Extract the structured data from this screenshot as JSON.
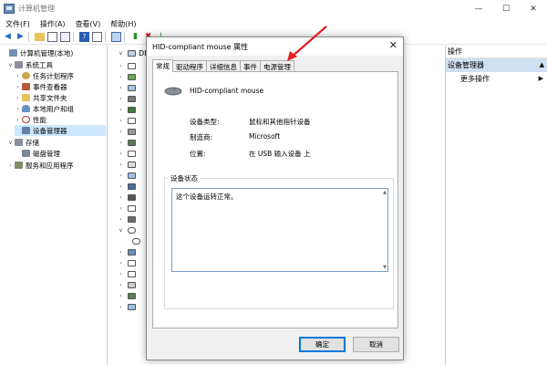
{
  "window": {
    "title": "计算机管理",
    "controls": [
      "—",
      "☐",
      "✕"
    ]
  },
  "menubar": [
    "文件(F)",
    "操作(A)",
    "查看(V)",
    "帮助(H)"
  ],
  "tree": {
    "root": "计算机管理(本地)",
    "system_tools": "系统工具",
    "task_scheduler": "任务计划程序",
    "event_viewer": "事件查看器",
    "shared_folders": "共享文件夹",
    "local_users": "本地用户和组",
    "performance": "性能",
    "device_manager": "设备管理器",
    "storage": "存储",
    "disk_management": "磁盘管理",
    "services": "服务和应用程序"
  },
  "middle": {
    "root_label": "DES"
  },
  "actions": {
    "header": "操作",
    "section": "设备管理器",
    "more": "更多操作"
  },
  "dialog": {
    "title": "HID-compliant mouse 属性",
    "tabs": [
      "常规",
      "驱动程序",
      "详细信息",
      "事件",
      "电源管理"
    ],
    "device_name": "HID-compliant mouse",
    "props": [
      {
        "label": "设备类型:",
        "value": "鼠标和其他指针设备"
      },
      {
        "label": "制造商:",
        "value": "Microsoft"
      },
      {
        "label": "位置:",
        "value": "在 USB 输入设备 上"
      }
    ],
    "status_group": "设备状态",
    "status_text": "这个设备运转正常。",
    "ok": "确定",
    "cancel": "取消"
  },
  "colors": {
    "selection": "#cce8ff",
    "accent": "#0078d7",
    "arrow": "#e02020"
  }
}
